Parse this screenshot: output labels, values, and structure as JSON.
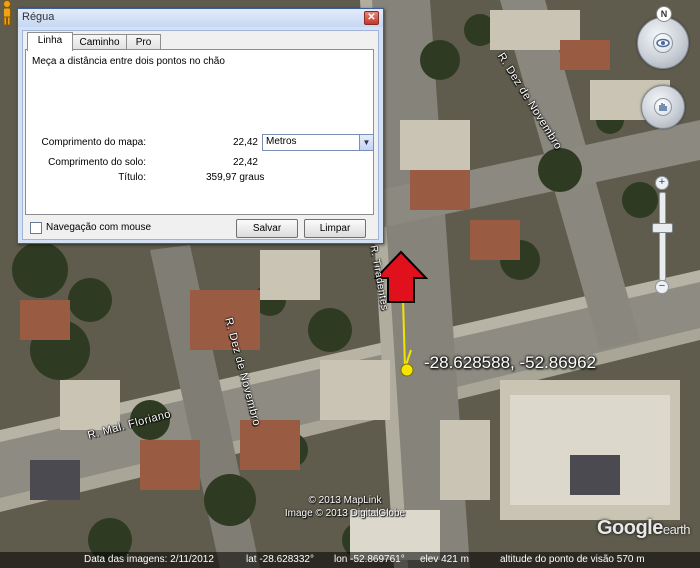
{
  "dialog": {
    "title": "Régua",
    "close_glyph": "✕",
    "tabs": [
      {
        "label": "Linha",
        "active": true
      },
      {
        "label": "Caminho",
        "active": false
      },
      {
        "label": "Pro",
        "active": false
      }
    ],
    "description": "Meça a distância entre dois pontos no chão",
    "map_length_label": "Comprimento do mapa:",
    "map_length_value": "22,42",
    "unit_selected": "Metros",
    "ground_length_label": "Comprimento do solo:",
    "ground_length_value": "22,42",
    "heading_label": "Título:",
    "heading_value": "359,97 graus",
    "mouse_nav_label": "Navegação com mouse",
    "mouse_nav_checked": false,
    "save_label": "Salvar",
    "clear_label": "Limpar"
  },
  "map": {
    "streets": [
      "R. Mal. Floriano",
      "R. Dez de Novembro",
      "R. Dez de Novembro",
      "R. Tiradentes"
    ],
    "placemark_label": "-28.628588, -52.86962",
    "copyright_lines": [
      "© 2013 MapLink",
      "Image © 2013 DigitalGlobe"
    ],
    "logo_main": "Google",
    "logo_sub": "earth",
    "annotation_color": "#e0101c"
  },
  "nav": {
    "north_label": "N",
    "zoom_in": "+",
    "zoom_out": "−",
    "zoom_level_fraction": 0.4
  },
  "status": {
    "imagery_date": "Data das imagens: 2/11/2012",
    "lat": "lat  -28.628332°",
    "lon": "lon  -52.869761°",
    "elev": "elev  421 m",
    "eye_alt": "altitude do ponto de visão  570 m"
  }
}
